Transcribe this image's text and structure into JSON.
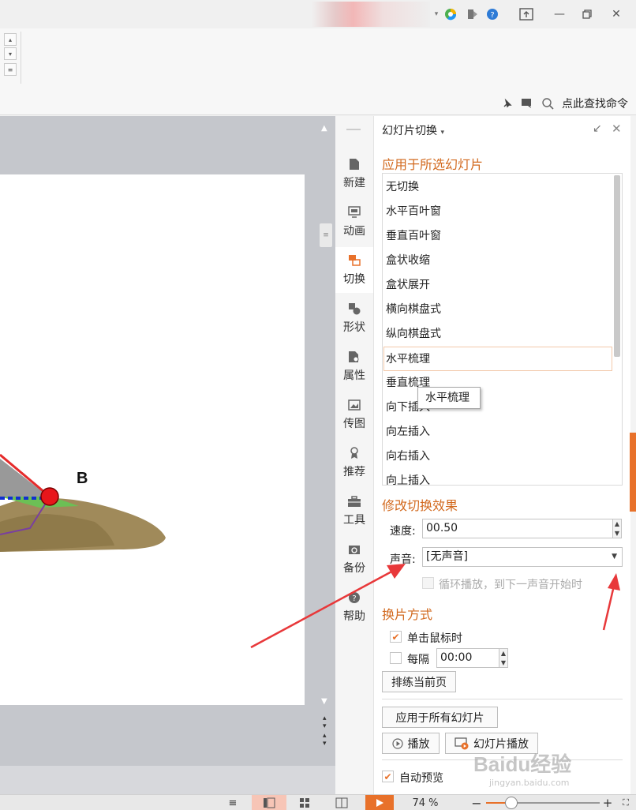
{
  "window": {
    "controls": [
      "minimize",
      "restore",
      "close"
    ]
  },
  "ribbon": {
    "search_label": "点此查找命令"
  },
  "slide": {
    "point_label": "B"
  },
  "sidetabs": [
    {
      "label": "新建",
      "icon": "file-icon"
    },
    {
      "label": "动画",
      "icon": "animation-icon"
    },
    {
      "label": "切换",
      "icon": "transition-icon",
      "active": true
    },
    {
      "label": "形状",
      "icon": "shape-icon"
    },
    {
      "label": "属性",
      "icon": "properties-icon"
    },
    {
      "label": "传图",
      "icon": "image-upload-icon"
    },
    {
      "label": "推荐",
      "icon": "recommend-icon"
    },
    {
      "label": "工具",
      "icon": "toolbox-icon"
    },
    {
      "label": "备份",
      "icon": "backup-icon"
    },
    {
      "label": "帮助",
      "icon": "help-icon"
    }
  ],
  "pane": {
    "title": "幻灯片切换",
    "apply_selected_title": "应用于所选幻灯片",
    "transitions": [
      "无切换",
      "水平百叶窗",
      "垂直百叶窗",
      "盒状收缩",
      "盒状展开",
      "横向棋盘式",
      "纵向棋盘式",
      "水平梳理",
      "垂直梳理",
      "向下插入",
      "向左插入",
      "向右插入",
      "向上插入"
    ],
    "selected_transition": "水平梳理",
    "tooltip": "水平梳理",
    "modify_title": "修改切换效果",
    "speed_label": "速度:",
    "speed_value": "00.50",
    "sound_label": "声音:",
    "sound_value": "[无声音]",
    "loop_label": "循环播放，到下一声音开始时",
    "advance_title": "换片方式",
    "on_click_label": "单击鼠标时",
    "on_click_checked": true,
    "every_label": "每隔",
    "every_value": "00:00",
    "every_checked": false,
    "rehearse_button": "排练当前页",
    "apply_all_button": "应用于所有幻灯片",
    "play_button": "播放",
    "slideshow_button": "幻灯片播放",
    "auto_preview_label": "自动预览",
    "auto_preview_checked": true
  },
  "statusbar": {
    "zoom": "74 %"
  },
  "watermark": {
    "text": "Baidu经验",
    "url": "jingyan.baidu.com"
  },
  "colors": {
    "accent": "#e8712a",
    "section_title": "#d2691e",
    "annotation_arrow": "#e8383a"
  }
}
